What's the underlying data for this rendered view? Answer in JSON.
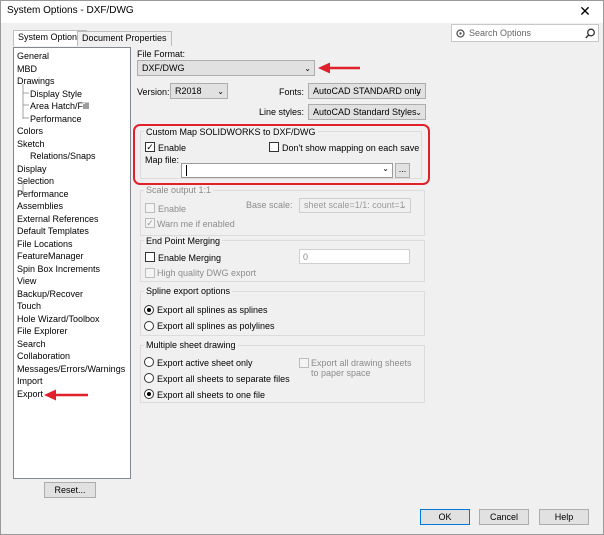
{
  "window": {
    "title": "System Options - DXF/DWG",
    "close_glyph": "✕"
  },
  "search": {
    "placeholder": "Search Options"
  },
  "tabs": [
    {
      "label": "System Options"
    },
    {
      "label": "Document Properties"
    }
  ],
  "tree": {
    "items": [
      {
        "label": "General"
      },
      {
        "label": "MBD"
      },
      {
        "label": "Drawings"
      },
      {
        "label": "Display Style"
      },
      {
        "label": "Area Hatch/Fill"
      },
      {
        "label": "Performance"
      },
      {
        "label": "Colors"
      },
      {
        "label": "Sketch"
      },
      {
        "label": "Relations/Snaps"
      },
      {
        "label": "Display"
      },
      {
        "label": "Selection"
      },
      {
        "label": "Performance"
      },
      {
        "label": "Assemblies"
      },
      {
        "label": "External References"
      },
      {
        "label": "Default Templates"
      },
      {
        "label": "File Locations"
      },
      {
        "label": "FeatureManager"
      },
      {
        "label": "Spin Box Increments"
      },
      {
        "label": "View"
      },
      {
        "label": "Backup/Recover"
      },
      {
        "label": "Touch"
      },
      {
        "label": "Hole Wizard/Toolbox"
      },
      {
        "label": "File Explorer"
      },
      {
        "label": "Search"
      },
      {
        "label": "Collaboration"
      },
      {
        "label": "Messages/Errors/Warnings"
      },
      {
        "label": "Import"
      },
      {
        "label": "Export"
      }
    ],
    "reset_label": "Reset..."
  },
  "file_format": {
    "label": "File Format:",
    "value": "DXF/DWG"
  },
  "version": {
    "label": "Version:",
    "value": "R2018"
  },
  "fonts": {
    "label": "Fonts:",
    "value": "AutoCAD STANDARD only"
  },
  "line_styles": {
    "label": "Line styles:",
    "value": "AutoCAD Standard Styles"
  },
  "custom_map": {
    "title": "Custom Map SOLIDWORKS to DXF/DWG",
    "enable_label": "Enable",
    "enable_checked": true,
    "dont_show_label": "Don't show mapping on each save",
    "map_file_label": "Map file:",
    "map_file_value": "",
    "browse_label": "..."
  },
  "scale_output": {
    "title": "Scale output 1:1",
    "enable_label": "Enable",
    "base_scale_label": "Base scale:",
    "base_scale_value": "sheet scale=1/1: count=1",
    "warn_label": "Warn me if enabled"
  },
  "end_point": {
    "title": "End Point Merging",
    "enable_label": "Enable Merging",
    "merge_value": "0",
    "hq_label": "High quality DWG export"
  },
  "spline": {
    "title": "Spline export options",
    "opt1": "Export all splines as splines",
    "opt2": "Export all splines as polylines"
  },
  "multi_sheet": {
    "title": "Multiple sheet drawing",
    "opt1": "Export active sheet only",
    "opt2": "Export all sheets to separate files",
    "opt3": "Export all sheets to one file",
    "paper_space_label": "Export all drawing sheets to paper space"
  },
  "buttons": {
    "ok": "OK",
    "cancel": "Cancel",
    "help": "Help"
  },
  "colors": {
    "annotation_red": "#e0202a",
    "ok_border": "#0078d7"
  }
}
